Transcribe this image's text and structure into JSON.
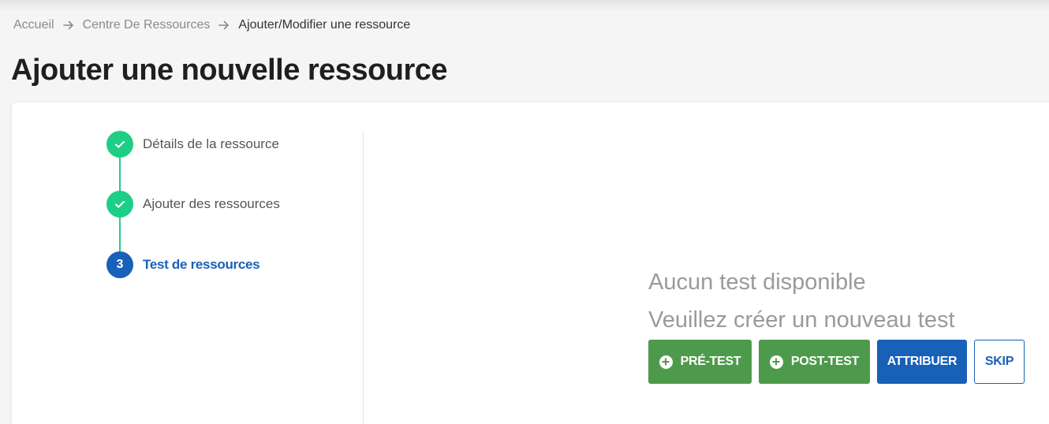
{
  "breadcrumb": {
    "items": [
      "Accueil",
      "Centre De Ressources",
      "Ajouter/Modifier une ressource"
    ],
    "separator_icon": "arrow-right-icon"
  },
  "page": {
    "title": "Ajouter une nouvelle ressource"
  },
  "stepper": {
    "steps": [
      {
        "label": "Détails de la ressource",
        "state": "completed",
        "icon": "check-icon"
      },
      {
        "label": "Ajouter des ressources",
        "state": "completed",
        "icon": "check-icon"
      },
      {
        "label": "Test de ressources",
        "state": "active",
        "number": "3"
      }
    ]
  },
  "empty_state": {
    "title": "Aucun test disponible",
    "subtitle": "Veuillez créer un nouveau test"
  },
  "actions": {
    "pre_test": {
      "label": "PRÉ-TEST",
      "icon": "plus-circle-icon"
    },
    "post_test": {
      "label": "POST-TEST",
      "icon": "plus-circle-icon"
    },
    "assign": {
      "label": "ATTRIBUER"
    },
    "skip": {
      "label": "SKIP"
    }
  },
  "colors": {
    "completed_step": "#1fce86",
    "active_step": "#1860b8",
    "green_button": "#4e9a4c",
    "blue_button": "#1860b8"
  }
}
